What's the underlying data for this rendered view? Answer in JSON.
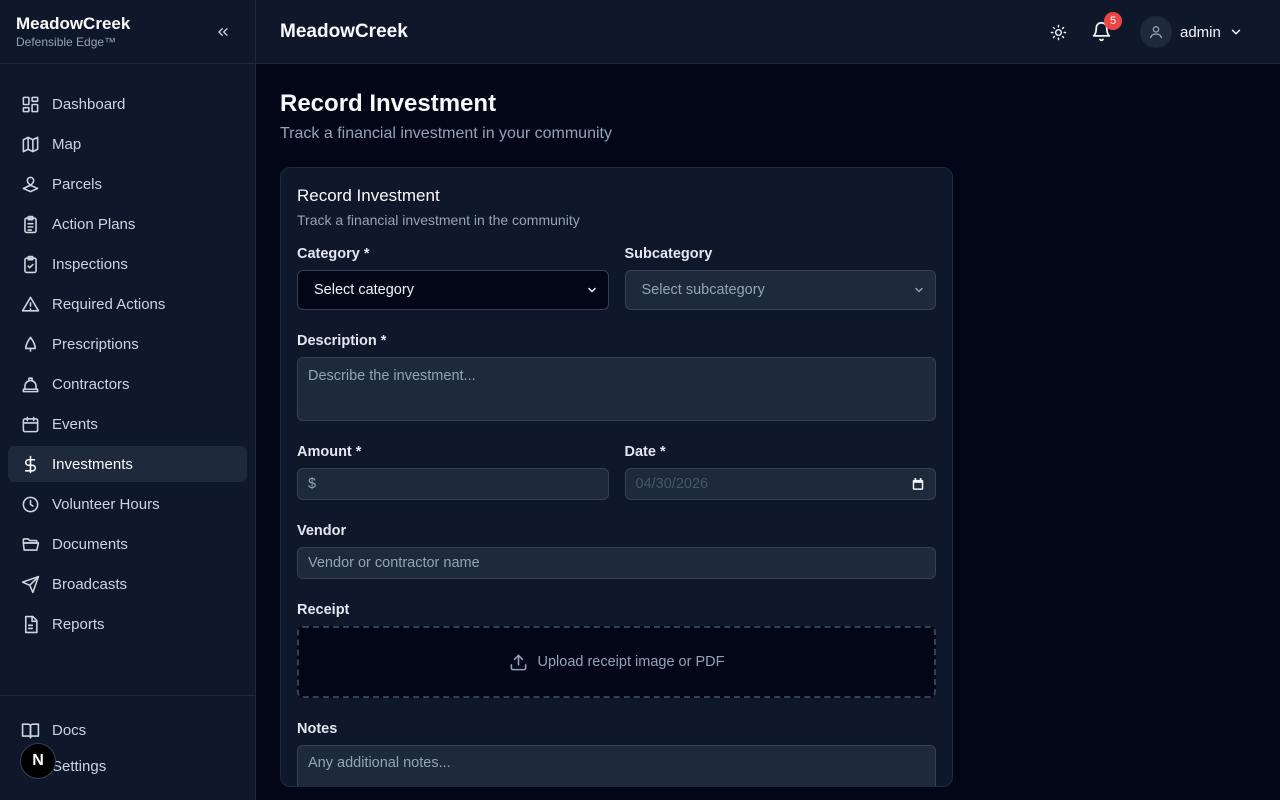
{
  "sidebar": {
    "brand_name": "MeadowCreek",
    "brand_sub": "Defensible Edge™",
    "items": [
      {
        "label": "Dashboard",
        "icon": "dashboard-icon"
      },
      {
        "label": "Map",
        "icon": "map-icon"
      },
      {
        "label": "Parcels",
        "icon": "parcels-icon"
      },
      {
        "label": "Action Plans",
        "icon": "clipboard-list-icon"
      },
      {
        "label": "Inspections",
        "icon": "clipboard-check-icon"
      },
      {
        "label": "Required Actions",
        "icon": "warning-icon"
      },
      {
        "label": "Prescriptions",
        "icon": "tree-icon"
      },
      {
        "label": "Contractors",
        "icon": "hard-hat-icon"
      },
      {
        "label": "Events",
        "icon": "calendar-icon"
      },
      {
        "label": "Investments",
        "icon": "dollar-icon",
        "active": true
      },
      {
        "label": "Volunteer Hours",
        "icon": "clock-icon"
      },
      {
        "label": "Documents",
        "icon": "folder-icon"
      },
      {
        "label": "Broadcasts",
        "icon": "send-icon"
      },
      {
        "label": "Reports",
        "icon": "file-text-icon"
      }
    ],
    "footer": [
      {
        "label": "Docs",
        "icon": "book-icon"
      },
      {
        "label": "Settings",
        "icon": "settings-icon"
      }
    ],
    "next_badge": "N"
  },
  "header": {
    "title": "MeadowCreek",
    "notification_count": "5",
    "user_name": "admin"
  },
  "page": {
    "title": "Record Investment",
    "subtitle": "Track a financial investment in your community"
  },
  "form": {
    "title": "Record Investment",
    "subtitle": "Track a financial investment in the community",
    "category_label": "Category *",
    "category_value": "Select category",
    "subcategory_label": "Subcategory",
    "subcategory_value": "Select subcategory",
    "description_label": "Description *",
    "description_placeholder": "Describe the investment...",
    "amount_label": "Amount *",
    "amount_prefix": "$",
    "date_label": "Date *",
    "date_value": "04/30/2026",
    "vendor_label": "Vendor",
    "vendor_placeholder": "Vendor or contractor name",
    "receipt_label": "Receipt",
    "receipt_upload_text": "Upload receipt image or PDF",
    "notes_label": "Notes",
    "notes_placeholder": "Any additional notes..."
  },
  "colors": {
    "background": "#020617",
    "panel": "#0f172a",
    "active_item": "#1e293b",
    "badge": "#ef4444"
  }
}
